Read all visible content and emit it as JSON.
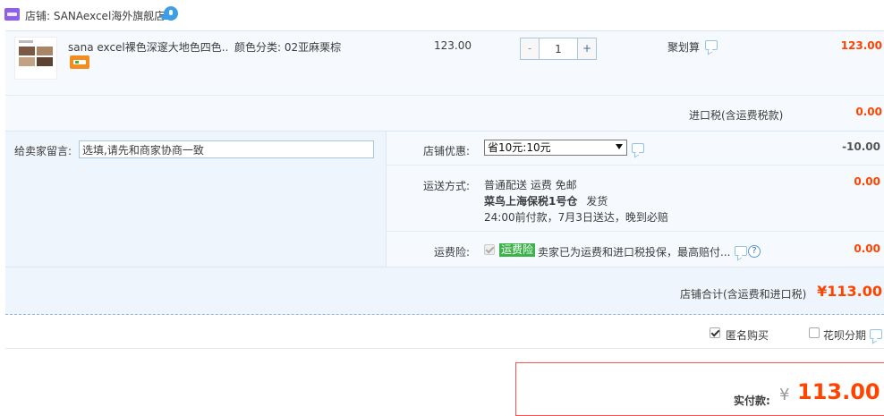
{
  "shop": {
    "label": "店铺:",
    "name": "SANAexcel海外旗舰店"
  },
  "item": {
    "title": "sana excel裸色深邃大地色四色...",
    "sku_label": "颜色分类:",
    "sku_value": "02亚麻栗棕",
    "unit_price": "123.00",
    "quantity": "1",
    "qty_minus": "-",
    "qty_plus": "+",
    "promotion": "聚划算",
    "total": "123.00"
  },
  "tax": {
    "label": "进口税(含运费税款)",
    "value": "0.00"
  },
  "message": {
    "label": "给卖家留言:",
    "value": "选填,请先和商家协商一致"
  },
  "coupon": {
    "label": "店铺优惠:",
    "selected": "省10元:10元",
    "value": "-10.00"
  },
  "shipping": {
    "label": "运送方式:",
    "line1": "普通配送 运费 免邮",
    "warehouse": "菜鸟上海保税1号仓",
    "ship_word": "发货",
    "line3": "24:00前付款，7月3日送达，晚到必赔",
    "value": "0.00"
  },
  "insurance": {
    "label": "运费险:",
    "tag": "运费险",
    "text": "卖家已为运费和进口税投保，最高赔付...",
    "help": "?",
    "value": "0.00"
  },
  "subtotal": {
    "label": "店铺合计(含运费和进口税)",
    "value": "¥113.00"
  },
  "options": {
    "anonymous": "匿名购买",
    "huabei": "花呗分期"
  },
  "payment": {
    "label": "实付款:",
    "currency": "¥",
    "amount": "113.00"
  },
  "colors": {
    "accent_red": "#ff4400",
    "panel_blue": "#eef5fd",
    "border_blue": "#a7c8e4",
    "insurance_green": "#3bb34a"
  }
}
